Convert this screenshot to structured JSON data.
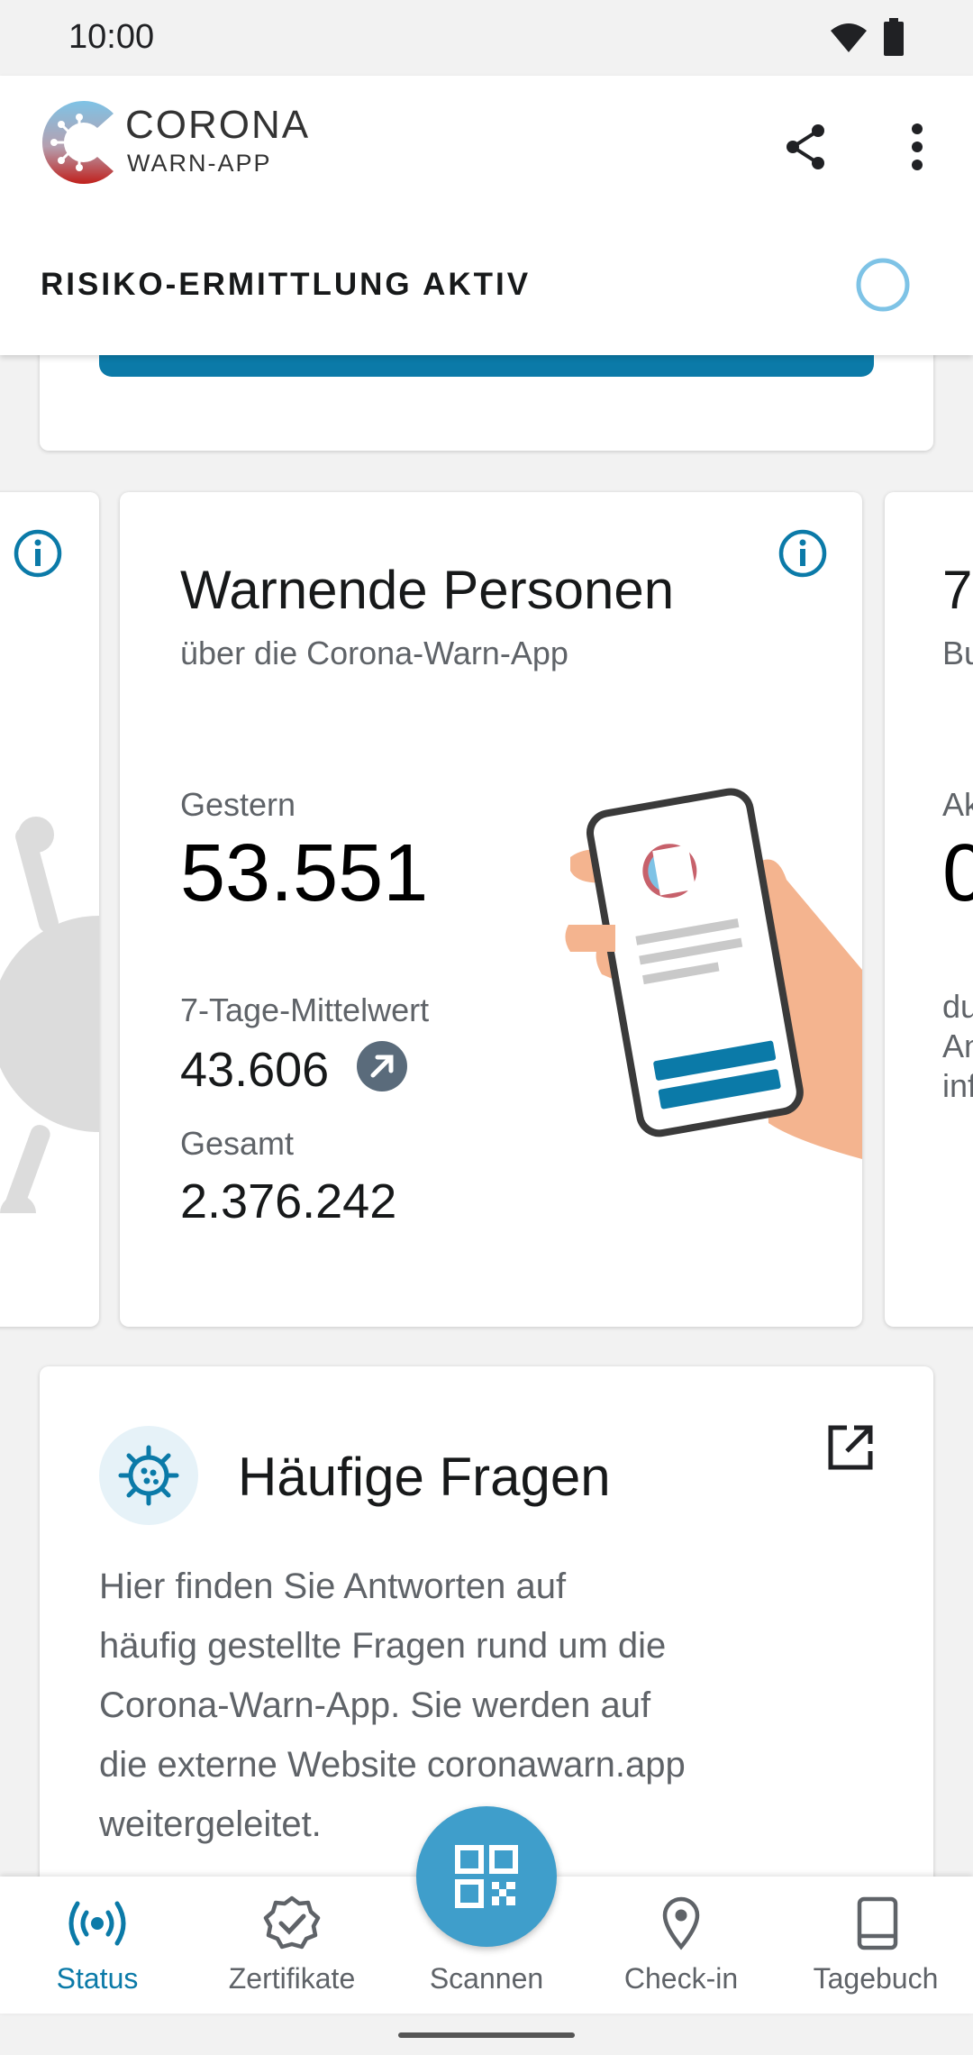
{
  "status_bar": {
    "time": "10:00"
  },
  "header": {
    "logo_line1": "CORONA",
    "logo_line2": "WARN-APP",
    "risk_status": "RISIKO-ERMITTLUNG AKTIV"
  },
  "stats_card": {
    "title": "Warnende Personen",
    "subtitle": "über die Corona-Warn-App",
    "yesterday_label": "Gestern",
    "yesterday_value": "53.551",
    "avg_label": "7-Tage-Mittelwert",
    "avg_value": "43.606",
    "total_label": "Gesamt",
    "total_value": "2.376.242"
  },
  "next_card_partial": {
    "title_fragment": "7",
    "subtitle_fragment": "Bu",
    "label_fragment": "Ak",
    "value_fragment": "0",
    "text_lines": [
      "du",
      "An",
      "inf"
    ]
  },
  "faq_card": {
    "title": "Häufige Fragen",
    "body_lines": [
      "Hier finden Sie Antworten auf",
      "häufig gestellte Fragen rund um die",
      "Corona-Warn-App. Sie werden auf",
      "die externe Website coronawarn.app",
      "weitergeleitet."
    ]
  },
  "bottom_nav": {
    "items": [
      {
        "label": "Status",
        "icon": "broadcast-icon",
        "active": true
      },
      {
        "label": "Zertifikate",
        "icon": "certificate-icon",
        "active": false
      },
      {
        "label": "Scannen",
        "icon": "qr-code-icon",
        "active": false
      },
      {
        "label": "Check-in",
        "icon": "location-pin-icon",
        "active": false
      },
      {
        "label": "Tagebuch",
        "icon": "book-icon",
        "active": false
      }
    ]
  },
  "colors": {
    "accent": "#0b7aa8",
    "fab": "#3f9ecb",
    "active_nav": "#0b7aa8",
    "inactive_nav": "#5f6368",
    "trend_badge": "#5a6b7b"
  }
}
